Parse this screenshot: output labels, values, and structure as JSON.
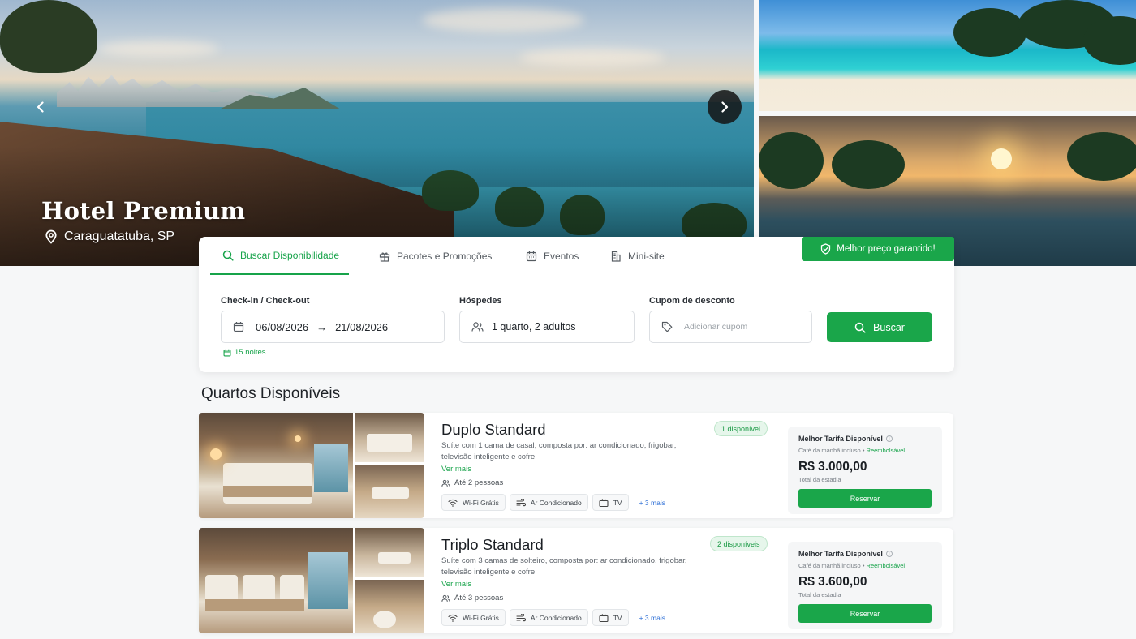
{
  "hotel": {
    "name": "Hotel Premium",
    "location": "Caraguatatuba, SP"
  },
  "tabs": [
    {
      "label": "Buscar Disponibilidade",
      "icon": "search-icon",
      "active": true
    },
    {
      "label": "Pacotes e Promoções",
      "icon": "gift-icon",
      "active": false
    },
    {
      "label": "Eventos",
      "icon": "calendar-icon",
      "active": false
    },
    {
      "label": "Mini-site",
      "icon": "building-icon",
      "active": false
    }
  ],
  "best_price_badge": "Melhor preço garantido!",
  "search": {
    "dates_label": "Check-in / Check-out",
    "checkin": "06/08/2026",
    "checkout": "21/08/2026",
    "guests_label": "Hóspedes",
    "guests_value": "1 quarto, 2 adultos",
    "coupon_label": "Cupom de desconto",
    "coupon_placeholder": "Adicionar cupom",
    "button_label": "Buscar",
    "nights": "15 noites"
  },
  "section_title": "Quartos Disponíveis",
  "rooms": [
    {
      "name": "Duplo Standard",
      "availability": "1 disponível",
      "description": "Suíte com 1 cama de casal, composta por: ar condicionado, frigobar, televisão inteligente e cofre.",
      "see_more": "Ver mais",
      "capacity": "Até 2 pessoas",
      "amenities": [
        "Wi-Fi Grátis",
        "Ar Condicionado",
        "TV"
      ],
      "more_amenities": "+ 3 mais",
      "rate_title": "Melhor Tarifa Disponível",
      "rate_breakfast": "Café da manhã incluso",
      "rate_refund": "Reembolsável",
      "price": "R$ 3.000,00",
      "price_note": "Total da estadia",
      "reserve_label": "Reservar"
    },
    {
      "name": "Triplo Standard",
      "availability": "2 disponíveis",
      "description": "Suíte com 3 camas de solteiro, composta por: ar condicionado, frigobar, televisão inteligente e cofre.",
      "see_more": "Ver mais",
      "capacity": "Até 3 pessoas",
      "amenities": [
        "Wi-Fi Grátis",
        "Ar Condicionado",
        "TV"
      ],
      "more_amenities": "+ 3 mais",
      "rate_title": "Melhor Tarifa Disponível",
      "rate_breakfast": "Café da manhã incluso",
      "rate_refund": "Reembolsável",
      "price": "R$ 3.600,00",
      "price_note": "Total da estadia",
      "reserve_label": "Reservar"
    }
  ],
  "colors": {
    "accent": "#1aa64a",
    "accent_text": "#17a34a",
    "link_blue": "#2d6fd6",
    "dark_arrow": "#141414"
  }
}
